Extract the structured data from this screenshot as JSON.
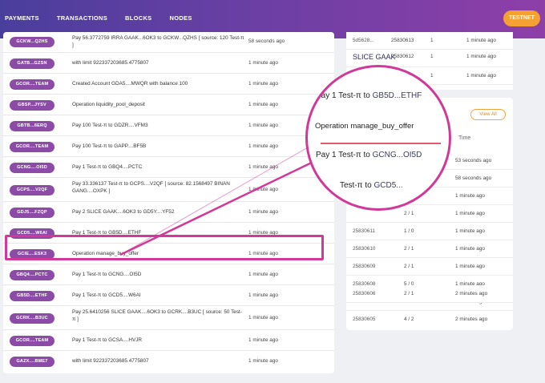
{
  "nav": {
    "items": [
      "PAYMENTS",
      "TRANSACTIONS",
      "BLOCKS",
      "NODES"
    ],
    "network_label": "TESTNET"
  },
  "operations": [
    {
      "account": "GCKW...QZHS",
      "description": "Pay 56.3772759 IRRA GAAK...6OK3 to GCKW...QZHS [ source: 120 Test-π ]",
      "time": "58 seconds ago"
    },
    {
      "account": "GATB...GZSN",
      "description": "with limit 922337203685.4775807",
      "time": "1 minute ago"
    },
    {
      "account": "GCOR....TEAM",
      "description": "Created Account GDA5....MWQR with balance 100",
      "time": "1 minute ago"
    },
    {
      "account": "GBSP...JYSV",
      "description": "Operation liquidity_pool_deposit",
      "time": "1 minute ago"
    },
    {
      "account": "GBTB...6ERQ",
      "description": "Pay 100 Test-π to GDZR....VFM3",
      "time": "1 minute ago"
    },
    {
      "account": "GCOR....TEAM",
      "description": "Pay 100 Test-π to GAPP....BF5B",
      "time": "1 minute ago"
    },
    {
      "account": "GCNG....OI5D",
      "description": "Pay 1 Test-π to GBQ4....PCTC",
      "time": "1 minute ago"
    },
    {
      "account": "GCPS....V2QF",
      "description": "Pay 33.336137 Test-π to GCPS....V2QF [ source: 82.1568497 BINAN GANG....OXPK ]",
      "time": "1 minute ago"
    },
    {
      "account": "GDJ5....FZQP",
      "description": "Pay 2 SLICE GAAK....6OK3 to GD5Y....YF52",
      "time": "1 minute ago"
    },
    {
      "account": "GCD5....W6AI",
      "description": "Pay 1 Test-π to GB5D....ETHF",
      "time": "1 minute ago"
    },
    {
      "account": "GCIE....ESK3",
      "description": "Operation manage_buy_offer",
      "time": "1 minute ago"
    },
    {
      "account": "GBQ4....PCTC",
      "description": "Pay 1 Test-π to GCNG....OI5D",
      "time": "1 minute ago"
    },
    {
      "account": "GB5D....ETHF",
      "description": "Pay 1 Test-π to GCD5....W6AI",
      "time": "1 minute ago"
    },
    {
      "account": "GCRK....B3UC",
      "description": "Pay 25.6410256 SLICE GAAK....6OK3 to GCRK....B3UC [ source: 50 Test-π ]",
      "time": "1 minute ago"
    },
    {
      "account": "GCOR....TEAM",
      "description": "Pay 1 Test-π to GCSA....HVJR",
      "time": "1 minute ago"
    },
    {
      "account": "GAZX....BME7",
      "description": "with limit 922337203685.4775807",
      "time": "1 minute ago"
    }
  ],
  "top_right": {
    "rows": [
      {
        "c1": "5d5628...",
        "c2": "25830613",
        "c3": "1",
        "c4": "1 minute ago"
      },
      {
        "c1": "",
        "c2": "25830612",
        "c3": "1",
        "c4": "1 minute ago"
      },
      {
        "c1": "",
        "c2": "",
        "c3": "1",
        "c4": "1 minute ago"
      }
    ],
    "slice_text": "SLICE  GAAK"
  },
  "ledgers": {
    "view_all_label": "View All",
    "time_header": "Time",
    "rows": [
      {
        "ledger": "",
        "ops": "",
        "time": "53 seconds ago"
      },
      {
        "ledger": "",
        "ops": "",
        "time": "58 seconds ago"
      },
      {
        "ledger": "",
        "ops": "",
        "time": "1 minute ago"
      },
      {
        "ledger": "",
        "ops": "2 / 1",
        "time": "1 minute ago"
      },
      {
        "ledger": "25830611",
        "ops": "1 / 0",
        "time": "1 minute ago"
      },
      {
        "ledger": "25830610",
        "ops": "2 / 1",
        "time": "1 minute ago"
      },
      {
        "ledger": "25830609",
        "ops": "2 / 1",
        "time": "1 minute ago"
      },
      {
        "ledger": "25830608",
        "ops": "5 / 0",
        "time": "1 minute ago"
      },
      {
        "ledger": "25830607",
        "ops": "5 / 0",
        "time": "1 minute ago"
      },
      {
        "ledger": "25830606",
        "ops": "2 / 1",
        "time": "2 minutes ago"
      },
      {
        "ledger": "25830605",
        "ops": "4 / 2",
        "time": "2 minutes ago"
      }
    ]
  },
  "magnifier": {
    "line1_prefix": "Pay 1 Test-π to",
    "line1_link": "GB5D...ETHF",
    "line2": "Operation manage_buy_offer",
    "line3_prefix": "Pay 1 Test-π to",
    "line3_link": "GCNG...OI5D",
    "line4_prefix": "Test-π to",
    "line4_link": "GCD5..."
  },
  "colors": {
    "badge": "#8b4ba6",
    "highlight": "#d0399a",
    "accent": "#f5a033"
  }
}
